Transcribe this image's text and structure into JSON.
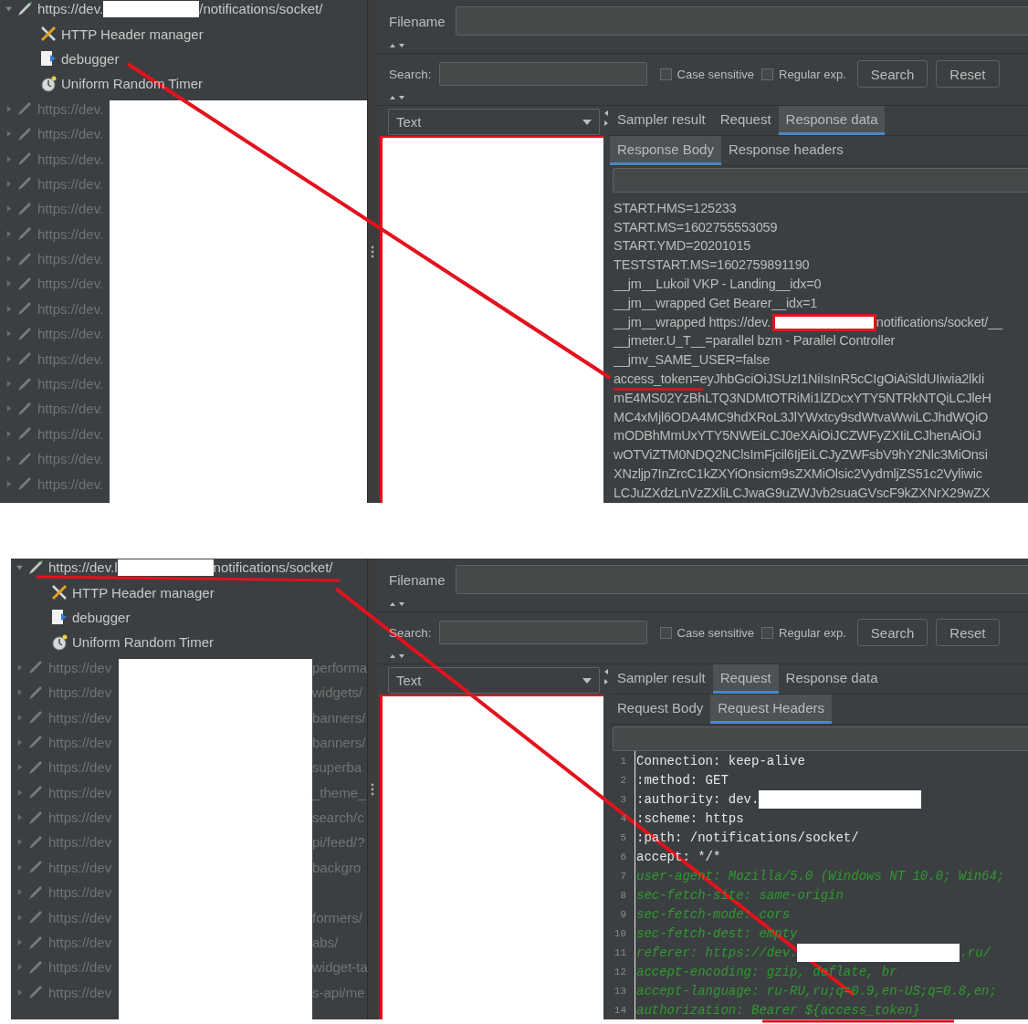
{
  "panels": [
    {
      "tree": [
        {
          "label_start": "https://dev.",
          "redacted": true,
          "label_end": "/notifications/socket/",
          "expanded": true,
          "disabled": false,
          "children": [
            {
              "kind": "header-manager",
              "label": "HTTP Header manager"
            },
            {
              "kind": "debug",
              "label": "debugger"
            },
            {
              "kind": "timer",
              "label": "Uniform Random Timer"
            }
          ]
        },
        {
          "label_start": "https://dev.",
          "expanded": false,
          "disabled": true
        },
        {
          "label_start": "https://dev.",
          "expanded": false,
          "disabled": true
        },
        {
          "label_start": "https://dev.",
          "expanded": false,
          "disabled": true
        },
        {
          "label_start": "https://dev.",
          "expanded": false,
          "disabled": true
        },
        {
          "label_start": "https://dev.",
          "expanded": false,
          "disabled": true
        },
        {
          "label_start": "https://dev.",
          "expanded": false,
          "disabled": true
        },
        {
          "label_start": "https://dev.",
          "expanded": false,
          "disabled": true
        },
        {
          "label_start": "https://dev.",
          "expanded": false,
          "disabled": true
        },
        {
          "label_start": "https://dev.",
          "expanded": false,
          "disabled": true
        },
        {
          "label_start": "https://dev.",
          "expanded": false,
          "disabled": true
        },
        {
          "label_start": "https://dev.",
          "expanded": false,
          "disabled": true
        },
        {
          "label_start": "https://dev.",
          "expanded": false,
          "disabled": true
        },
        {
          "label_start": "https://dev.",
          "expanded": false,
          "disabled": true
        },
        {
          "label_start": "https://dev.",
          "expanded": false,
          "disabled": true
        },
        {
          "label_start": "https://dev.",
          "expanded": false,
          "disabled": true
        },
        {
          "label_start": "https://dev.",
          "expanded": false,
          "disabled": true
        }
      ],
      "filename_label": "Filename",
      "search_label": "Search:",
      "checkboxes": [
        {
          "label": "Case sensitive",
          "checked": false
        },
        {
          "label": "Regular exp.",
          "checked": false
        }
      ],
      "buttons": [
        "Search",
        "Reset"
      ],
      "renderer": "Text",
      "tabs": [
        {
          "label": "Sampler result",
          "selected": false
        },
        {
          "label": "Request",
          "selected": false
        },
        {
          "label": "Response data",
          "selected": true
        }
      ],
      "subtabs": [
        {
          "label": "Response Body",
          "selected": true
        },
        {
          "label": "Response headers",
          "selected": false
        }
      ],
      "content": {
        "kind": "text",
        "lines": [
          {
            "text": "START.HMS=125233"
          },
          {
            "text": "START.MS=1602755553059"
          },
          {
            "text": "START.YMD=20201015"
          },
          {
            "text": "TESTSTART.MS=1602759891190"
          },
          {
            "text": "__jm__Lukoil VKP - Landing__idx=0"
          },
          {
            "text": "__jm__wrapped Get Bearer__idx=1"
          },
          {
            "text": "__jm__wrapped https://dev.",
            "redacted": true,
            "boxed": true,
            "tail": "notifications/socket/__"
          },
          {
            "text": "__jmeter.U_T__=parallel bzm - Parallel Controller"
          },
          {
            "text": "__jmv_SAME_USER=false"
          },
          {
            "text": "access_token=eyJhbGciOiJSUzI1NiIsInR5cCIgOiAiSldUIiwia2lkIi"
          },
          {
            "text": "mE4MS02YzBhLTQ3NDMtOTRiMi1lZDcxYTY5NTRkNTQiLCJleH"
          },
          {
            "text": "MC4xMjl6ODA4MC9hdXRoL3JlYWxtcy9sdWtvaWwiLCJhdWQiO"
          },
          {
            "text": "mODBhMmUxYTY5NWEiLCJ0eXAiOiJCZWFyZXIiLCJhenAiOiJ"
          },
          {
            "text": "wOTViZTM0NDQ2NClsImFjcil6IjEiLCJyZWFsbV9hY2Nlc3MiOnsi"
          },
          {
            "text": "XNzljp7InZrcC1kZXYiOnsicm9sZXMiOlsic2VydmljZS51c2Vyliwic"
          },
          {
            "text": "LCJuZXdzLnVzZXliLCJwaG9uZWJvb2suaGVscF9kZXNrX29wZX"
          }
        ]
      }
    },
    {
      "tree": [
        {
          "label_start": "https://dev.l",
          "redacted": true,
          "label_end": "notifications/socket/",
          "expanded": true,
          "disabled": false,
          "children": [
            {
              "kind": "header-manager",
              "label": "HTTP Header manager"
            },
            {
              "kind": "debug",
              "label": "debugger"
            },
            {
              "kind": "timer",
              "label": "Uniform Random Timer"
            }
          ]
        },
        {
          "label_start": "https://dev",
          "label_end": "performa",
          "expanded": false,
          "disabled": true
        },
        {
          "label_start": "https://dev",
          "label_end": "widgets/",
          "expanded": false,
          "disabled": true
        },
        {
          "label_start": "https://dev",
          "label_end": "banners/",
          "expanded": false,
          "disabled": true
        },
        {
          "label_start": "https://dev",
          "label_end": "banners/",
          "expanded": false,
          "disabled": true
        },
        {
          "label_start": "https://dev",
          "label_end": "superba",
          "expanded": false,
          "disabled": true
        },
        {
          "label_start": "https://dev",
          "label_end": "_theme_",
          "expanded": false,
          "disabled": true
        },
        {
          "label_start": "https://dev",
          "label_end": "search/c",
          "expanded": false,
          "disabled": true
        },
        {
          "label_start": "https://dev",
          "label_end": "pi/feed/?",
          "expanded": false,
          "disabled": true
        },
        {
          "label_start": "https://dev",
          "label_end": "backgro",
          "expanded": false,
          "disabled": true
        },
        {
          "label_start": "https://dev",
          "expanded": false,
          "disabled": true
        },
        {
          "label_start": "https://dev",
          "label_end": "formers/",
          "expanded": false,
          "disabled": true
        },
        {
          "label_start": "https://dev",
          "label_end": "abs/",
          "expanded": false,
          "disabled": true
        },
        {
          "label_start": "https://dev",
          "label_end": "widget-ta",
          "expanded": false,
          "disabled": true
        },
        {
          "label_start": "https://dev",
          "label_end": "s-api/me",
          "expanded": false,
          "disabled": true
        }
      ],
      "filename_label": "Filename",
      "search_label": "Search:",
      "checkboxes": [
        {
          "label": "Case sensitive",
          "checked": false
        },
        {
          "label": "Regular exp.",
          "checked": false
        }
      ],
      "buttons": [
        "Search",
        "Reset"
      ],
      "renderer": "Text",
      "tabs": [
        {
          "label": "Sampler result",
          "selected": false
        },
        {
          "label": "Request",
          "selected": true
        },
        {
          "label": "Response data",
          "selected": false
        }
      ],
      "subtabs": [
        {
          "label": "Request Body",
          "selected": false
        },
        {
          "label": "Request Headers",
          "selected": true
        }
      ],
      "content": {
        "kind": "code",
        "lines": [
          {
            "number": "1",
            "kind": "plain",
            "text": "Connection: keep-alive"
          },
          {
            "number": "2",
            "kind": "plain",
            "text": ":method: GET"
          },
          {
            "number": "3",
            "kind": "plain",
            "text": ":authority: dev.",
            "redacted": true
          },
          {
            "number": "4",
            "kind": "plain",
            "text": ":scheme: https"
          },
          {
            "number": "5",
            "kind": "plain",
            "text": ":path: /notifications/socket/"
          },
          {
            "number": "6",
            "kind": "plain",
            "text": "accept: */*"
          },
          {
            "number": "7",
            "kind": "comment",
            "text": "user-agent: Mozilla/5.0 (Windows NT 10.0; Win64;"
          },
          {
            "number": "8",
            "kind": "comment",
            "text": "sec-fetch-site: same-origin"
          },
          {
            "number": "9",
            "kind": "comment",
            "text": "sec-fetch-mode: cors"
          },
          {
            "number": "10",
            "kind": "comment",
            "text": "sec-fetch-dest: empty"
          },
          {
            "number": "11",
            "kind": "comment",
            "text": "referer: https://dev.",
            "redacted": true,
            "tail": ".ru/"
          },
          {
            "number": "12",
            "kind": "comment",
            "text": "accept-encoding: gzip, deflate, br"
          },
          {
            "number": "13",
            "kind": "comment",
            "text": "accept-language: ru-RU,ru;q=0.9,en-US;q=0.8,en;"
          },
          {
            "number": "14",
            "kind": "comment",
            "text": "authorization: Bearer ${access_token}"
          }
        ]
      }
    }
  ]
}
